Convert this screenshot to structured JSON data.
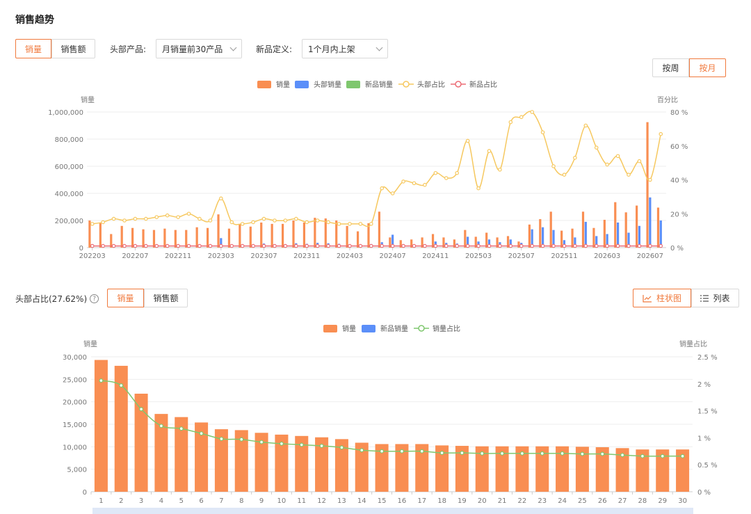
{
  "page": {
    "title": "销售趋势",
    "tabs1": [
      "销量",
      "销售额"
    ],
    "head_product_label": "头部产品:",
    "head_product_value": "月销量前30产品",
    "new_def_label": "新品定义:",
    "new_def_value": "1个月内上架",
    "period_btns": [
      "按周",
      "按月"
    ],
    "share_label": "头部占比(27.62%)",
    "help_glyph": "?",
    "tabs2": [
      "销量",
      "销售额"
    ],
    "view_btns": [
      "柱状图",
      "列表"
    ]
  },
  "chart_data": [
    {
      "type": "bar",
      "legend": [
        "销量",
        "头部销量",
        "新品销量",
        "头部占比",
        "新品占比"
      ],
      "ylabel_left": "销量",
      "ylabel_right": "百分比",
      "ylim_left": [
        0,
        1000000
      ],
      "ylim_right": [
        0,
        80
      ],
      "yticks_left": [
        "0",
        "200,000",
        "400,000",
        "600,000",
        "800,000",
        "1,000,000"
      ],
      "yticks_right": [
        "0 %",
        "20 %",
        "40 %",
        "60 %",
        "80 %"
      ],
      "xticks": [
        "202203",
        "202207",
        "202211",
        "202303",
        "202307",
        "202311",
        "202403",
        "202407",
        "202411",
        "202503",
        "202507",
        "202511",
        "202603",
        "202607"
      ],
      "categories": [
        "202203",
        "202204",
        "202205",
        "202206",
        "202207",
        "202208",
        "202209",
        "202210",
        "202211",
        "202212",
        "202301",
        "202302",
        "202303",
        "202304",
        "202305",
        "202306",
        "202307",
        "202308",
        "202309",
        "202310",
        "202311",
        "202312",
        "202401",
        "202402",
        "202403",
        "202404",
        "202405",
        "202406",
        "202407",
        "202408",
        "202409",
        "202410",
        "202411",
        "202412",
        "202501",
        "202502",
        "202503",
        "202504",
        "202505",
        "202506",
        "202507",
        "202508",
        "202509",
        "202510",
        "202511",
        "202512",
        "202601",
        "202602",
        "202603",
        "202604",
        "202605",
        "202606",
        "202607",
        "202608"
      ],
      "series": [
        {
          "name": "销量",
          "values": [
            200000,
            180000,
            100000,
            160000,
            145000,
            135000,
            130000,
            140000,
            130000,
            130000,
            150000,
            145000,
            245000,
            140000,
            170000,
            155000,
            185000,
            175000,
            175000,
            200000,
            185000,
            220000,
            215000,
            200000,
            160000,
            120000,
            180000,
            265000,
            75000,
            55000,
            60000,
            75000,
            100000,
            75000,
            60000,
            130000,
            80000,
            110000,
            75000,
            85000,
            45000,
            170000,
            210000,
            265000,
            125000,
            140000,
            265000,
            145000,
            205000,
            335000,
            260000,
            310000,
            925000,
            295000
          ]
        },
        {
          "name": "头部销量",
          "values": [
            25000,
            20000,
            15000,
            18000,
            16000,
            15000,
            14000,
            16000,
            14000,
            14000,
            17000,
            16000,
            70000,
            15000,
            22000,
            18000,
            30000,
            25000,
            25000,
            32000,
            28000,
            35000,
            32000,
            28000,
            22000,
            18000,
            26000,
            40000,
            95000,
            25000,
            20000,
            25000,
            45000,
            35000,
            30000,
            80000,
            45000,
            60000,
            40000,
            60000,
            35000,
            135000,
            150000,
            130000,
            55000,
            75000,
            190000,
            85000,
            100000,
            185000,
            110000,
            160000,
            370000,
            200000
          ]
        },
        {
          "name": "新品销量",
          "values": [
            0,
            0,
            0,
            0,
            0,
            0,
            0,
            0,
            0,
            0,
            0,
            0,
            0,
            0,
            0,
            0,
            0,
            0,
            0,
            0,
            0,
            0,
            0,
            0,
            0,
            0,
            0,
            0,
            0,
            0,
            0,
            0,
            0,
            0,
            0,
            0,
            0,
            0,
            0,
            0,
            0,
            0,
            0,
            0,
            0,
            0,
            0,
            0,
            0,
            0,
            0,
            0,
            0,
            0
          ]
        },
        {
          "name": "头部占比",
          "values": [
            14,
            15,
            17,
            16,
            17,
            17,
            18,
            19,
            18,
            20,
            17,
            16,
            29,
            15,
            14,
            15,
            17,
            16,
            16,
            17,
            15,
            16,
            15,
            14,
            14,
            14,
            14,
            35,
            32,
            39,
            38,
            37,
            44,
            41,
            44,
            63,
            35,
            57,
            46,
            74,
            77,
            80,
            68,
            48,
            43,
            53,
            72,
            59,
            49,
            54,
            43,
            51,
            40,
            67
          ]
        },
        {
          "name": "新品占比",
          "values": [
            1,
            1,
            1,
            1,
            1,
            1,
            1,
            1,
            1,
            1,
            1,
            1,
            1,
            1,
            1,
            1,
            1,
            1,
            1,
            1,
            1,
            1,
            1,
            1,
            1,
            1,
            1,
            1,
            1,
            1,
            1,
            1,
            1,
            1,
            1,
            1,
            1,
            1,
            1,
            1,
            1,
            1,
            1,
            1,
            1,
            1,
            1,
            1,
            1,
            1,
            1,
            1,
            1,
            1
          ]
        }
      ],
      "colors": {
        "sales": "#f98e52",
        "head": "#5b8ff9",
        "new": "#7fc76e",
        "head_pct": "#f6c85f",
        "new_pct": "#ec6b74"
      }
    },
    {
      "type": "bar",
      "legend": [
        "销量",
        "新品销量",
        "销量占比"
      ],
      "ylabel_left": "销量",
      "ylabel_right": "销量占比",
      "ylim_left": [
        0,
        30000
      ],
      "ylim_right": [
        0,
        2.5
      ],
      "yticks_left": [
        "0",
        "5,000",
        "10,000",
        "15,000",
        "20,000",
        "25,000",
        "30,000"
      ],
      "yticks_right": [
        "0 %",
        "0.5 %",
        "1 %",
        "1.5 %",
        "2 %",
        "2.5 %"
      ],
      "categories": [
        "1",
        "2",
        "3",
        "4",
        "5",
        "6",
        "7",
        "8",
        "9",
        "10",
        "11",
        "12",
        "13",
        "14",
        "15",
        "16",
        "17",
        "18",
        "19",
        "20",
        "21",
        "22",
        "23",
        "24",
        "25",
        "26",
        "27",
        "28",
        "29",
        "30"
      ],
      "series": [
        {
          "name": "销量",
          "values": [
            29300,
            28000,
            21800,
            17300,
            16600,
            15400,
            13900,
            13700,
            13100,
            12700,
            12400,
            12100,
            11700,
            10900,
            10600,
            10600,
            10600,
            10300,
            10200,
            10100,
            10100,
            10100,
            10100,
            10100,
            10000,
            9900,
            9700,
            9400,
            9400,
            9400
          ]
        },
        {
          "name": "新品销量",
          "values": [
            0,
            0,
            0,
            0,
            0,
            0,
            0,
            0,
            0,
            0,
            0,
            0,
            0,
            0,
            0,
            0,
            0,
            0,
            0,
            0,
            0,
            0,
            0,
            0,
            0,
            0,
            0,
            0,
            0,
            0
          ]
        },
        {
          "name": "销量占比",
          "values": [
            2.06,
            1.97,
            1.53,
            1.22,
            1.17,
            1.08,
            0.98,
            0.97,
            0.92,
            0.89,
            0.87,
            0.85,
            0.82,
            0.77,
            0.75,
            0.75,
            0.75,
            0.72,
            0.72,
            0.71,
            0.71,
            0.71,
            0.71,
            0.71,
            0.7,
            0.7,
            0.68,
            0.66,
            0.66,
            0.66
          ]
        }
      ],
      "colors": {
        "sales": "#f98e52",
        "new": "#5b8ff9",
        "pct": "#7fc76e"
      }
    }
  ]
}
